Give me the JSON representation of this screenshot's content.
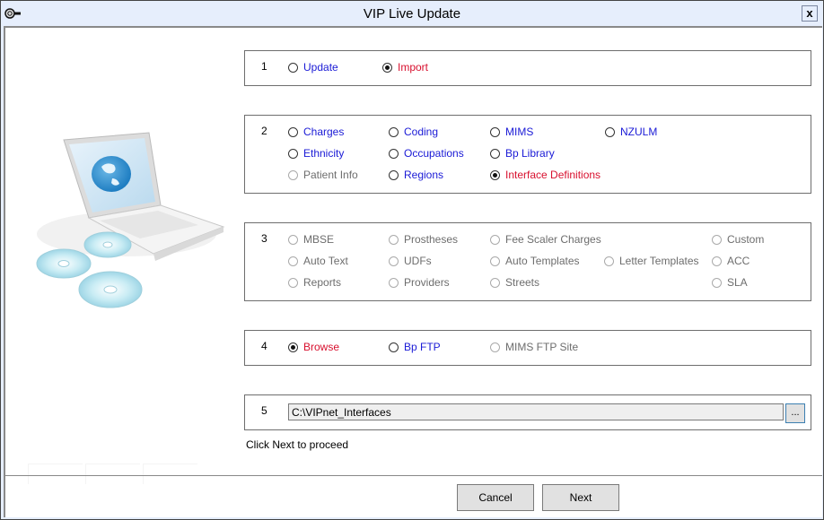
{
  "window": {
    "title": "VIP Live Update",
    "close_label": "x"
  },
  "icons": {
    "app": "key-settings-icon",
    "close": "close-icon",
    "illustration": "laptop-discs-illustration"
  },
  "groups": {
    "g1": {
      "number": "1",
      "options": [
        {
          "label": "Update",
          "state": "enabled"
        },
        {
          "label": "Import",
          "state": "checked"
        }
      ]
    },
    "g2": {
      "number": "2",
      "options": [
        {
          "label": "Charges",
          "state": "enabled"
        },
        {
          "label": "Coding",
          "state": "enabled"
        },
        {
          "label": "MIMS",
          "state": "enabled"
        },
        {
          "label": "NZULM",
          "state": "enabled"
        },
        {
          "label": "Ethnicity",
          "state": "enabled"
        },
        {
          "label": "Occupations",
          "state": "enabled"
        },
        {
          "label": "Bp Library",
          "state": "enabled"
        },
        {
          "label": "Patient Info",
          "state": "disabled"
        },
        {
          "label": "Regions",
          "state": "enabled"
        },
        {
          "label": "Interface Definitions",
          "state": "checked"
        }
      ]
    },
    "g3": {
      "number": "3",
      "options": [
        {
          "label": "MBSE",
          "state": "disabled"
        },
        {
          "label": "Prostheses",
          "state": "disabled"
        },
        {
          "label": "Fee Scaler Charges",
          "state": "disabled"
        },
        {
          "label": "Custom",
          "state": "disabled"
        },
        {
          "label": "Auto Text",
          "state": "disabled"
        },
        {
          "label": "UDFs",
          "state": "disabled"
        },
        {
          "label": "Auto Templates",
          "state": "disabled"
        },
        {
          "label": "Letter Templates",
          "state": "disabled"
        },
        {
          "label": "ACC",
          "state": "disabled"
        },
        {
          "label": "Reports",
          "state": "disabled"
        },
        {
          "label": "Providers",
          "state": "disabled"
        },
        {
          "label": "Streets",
          "state": "disabled"
        },
        {
          "label": "SLA",
          "state": "disabled"
        }
      ]
    },
    "g4": {
      "number": "4",
      "options": [
        {
          "label": "Browse",
          "state": "checked"
        },
        {
          "label": "Bp FTP",
          "state": "enabled"
        },
        {
          "label": "MIMS FTP Site",
          "state": "disabled"
        }
      ]
    },
    "g5": {
      "number": "5",
      "path_value": "C:\\VIPnet_Interfaces",
      "browse_label": "..."
    }
  },
  "hint": "Click Next to proceed",
  "buttons": {
    "cancel": "Cancel",
    "next": "Next"
  }
}
